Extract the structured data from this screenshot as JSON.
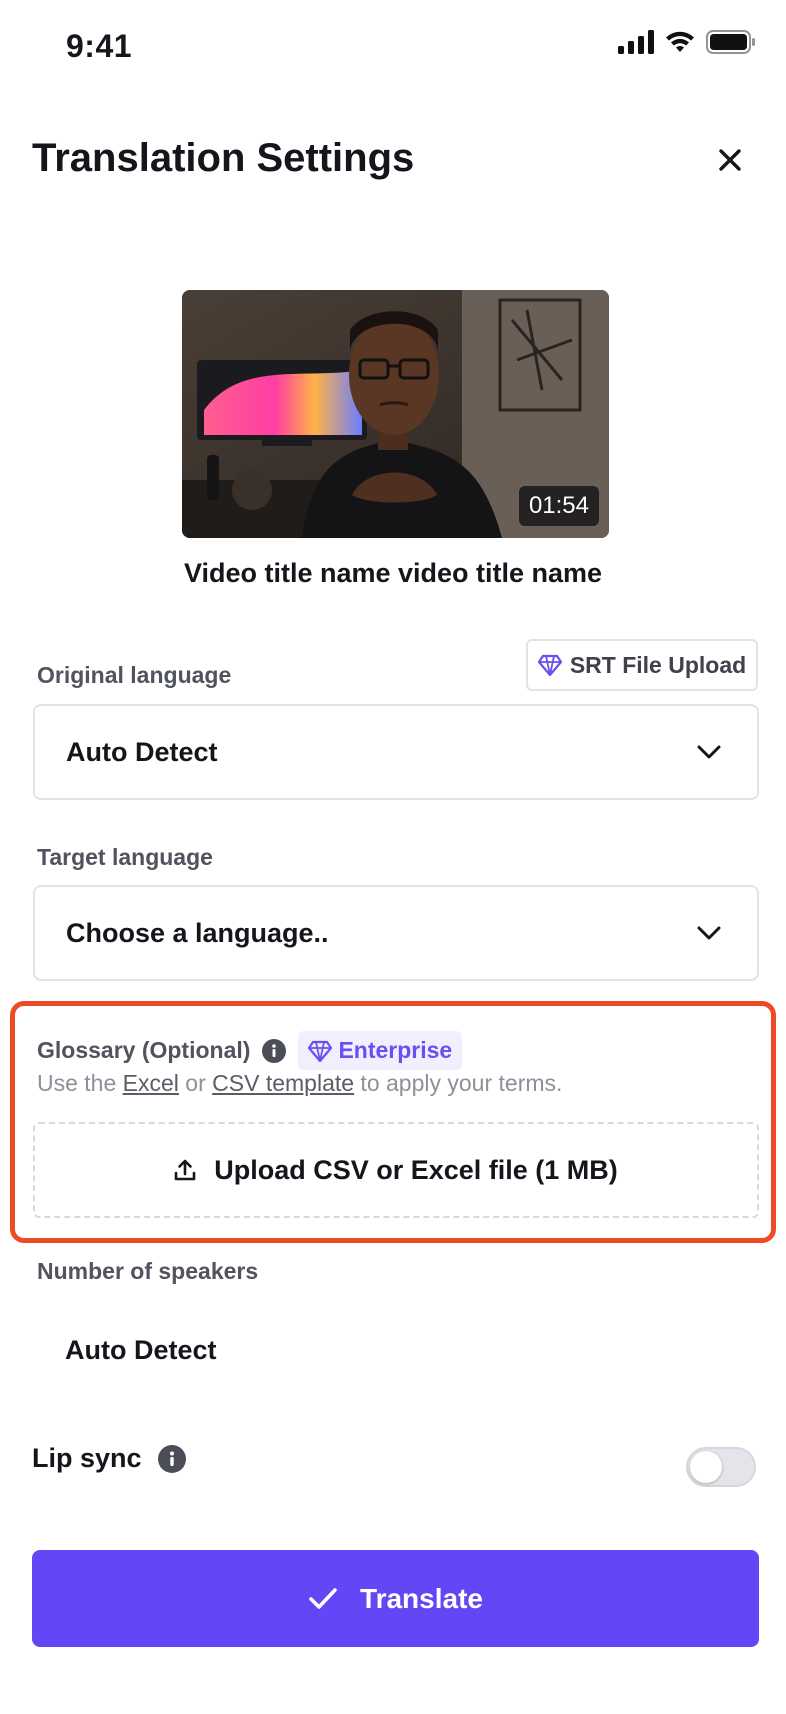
{
  "status_bar": {
    "time": "9:41"
  },
  "header": {
    "title": "Translation Settings"
  },
  "video": {
    "duration": "01:54",
    "title": "Video title name video title name"
  },
  "original_language": {
    "label": "Original language",
    "value": "Auto Detect",
    "srt_button": "SRT File Upload"
  },
  "target_language": {
    "label": "Target language",
    "value": "Choose a language.."
  },
  "glossary": {
    "label": "Glossary (Optional)",
    "badge": "Enterprise",
    "help_prefix": "Use the ",
    "excel_link": "Excel",
    "help_or": " or ",
    "csv_link": "CSV template",
    "help_suffix": " to apply your terms.",
    "upload_label": "Upload CSV or Excel file (1 MB)"
  },
  "speakers": {
    "label": "Number of speakers",
    "value": "Auto Detect"
  },
  "lip_sync": {
    "label": "Lip sync",
    "enabled": false
  },
  "primary_action": {
    "label": "Translate"
  },
  "colors": {
    "accent": "#6147f5",
    "highlight_border": "#ec4b26",
    "badge_text": "#6a4ef0"
  }
}
